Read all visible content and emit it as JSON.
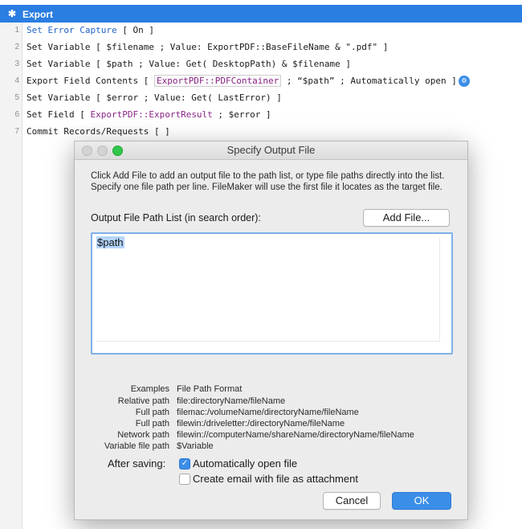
{
  "window": {
    "title": "Export"
  },
  "script_lines": [
    {
      "n": "1"
    },
    {
      "n": "2"
    },
    {
      "n": "3"
    },
    {
      "n": "4"
    },
    {
      "n": "5"
    },
    {
      "n": "6"
    },
    {
      "n": "7"
    }
  ],
  "code": {
    "l1a": "Set Error Capture",
    "l1b": " [ On ]",
    "l2": "Set Variable [ $filename ; Value: ExportPDF::BaseFileName & \".pdf\" ]",
    "l3": "Set Variable [ $path ; Value: Get( DesktopPath) & $filename ]",
    "l4a": "Export Field Contents [ ",
    "l4b": "ExportPDF::PDFContainer",
    "l4c": " ; “$path” ; Automatically open ]",
    "l5": "Set Variable [ $error ; Value: Get( LastError) ]",
    "l6a": "Set Field [ ",
    "l6b": "ExportPDF::ExportResult",
    "l6c": " ; $error ]",
    "l7": "Commit Records/Requests [ ]"
  },
  "dialog": {
    "title": "Specify Output File",
    "description": "Click Add File to add an output file to the path list, or type file paths directly into the list. Specify one file path per line. FileMaker will use the first file it locates as the target file.",
    "list_label": "Output File Path List (in search order):",
    "add_file": "Add File...",
    "path_value": "$path",
    "examples_header": "Examples",
    "format_header": "File Path Format",
    "examples": [
      {
        "label": "Relative path",
        "value": "file:directoryName/fileName"
      },
      {
        "label": "Full path",
        "value": "filemac:/volumeName/directoryName/fileName"
      },
      {
        "label": "Full path",
        "value": "filewin:/driveletter:/directoryName/fileName"
      },
      {
        "label": "Network path",
        "value": "filewin://computerName/shareName/directoryName/fileName"
      },
      {
        "label": "Variable file path",
        "value": "$Variable"
      }
    ],
    "after_saving": "After saving:",
    "auto_open": "Automatically open file",
    "create_email": "Create email with file as attachment",
    "cancel": "Cancel",
    "ok": "OK"
  }
}
